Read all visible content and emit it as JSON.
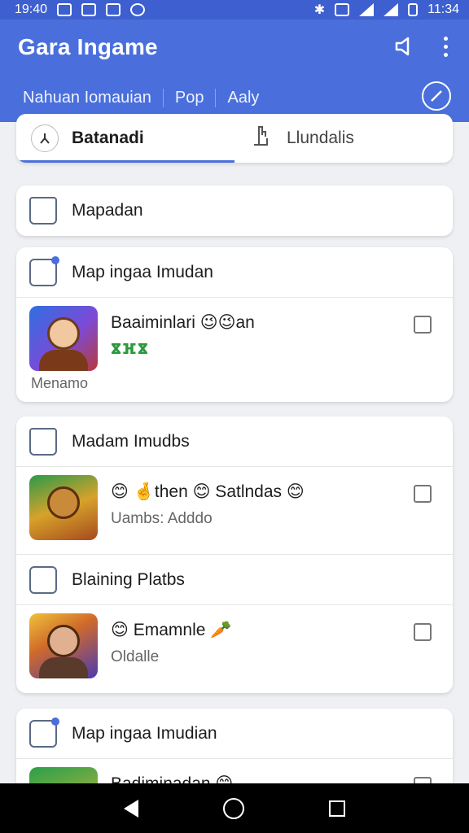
{
  "status_bar": {
    "time_left": "19:40",
    "time_right": "11:34"
  },
  "app": {
    "title": "Gara Ingame"
  },
  "subtabs": [
    "Nahuan Iomauian",
    "Pop",
    "Aaly"
  ],
  "segment_tabs": [
    {
      "label": "Batanadi",
      "icon": "person-icon",
      "active": true
    },
    {
      "label": "Llundalis",
      "icon": "hand-pointer-icon",
      "active": false
    }
  ],
  "cards": {
    "c1": {
      "section": "Mapadan"
    },
    "c2": {
      "section": "Map ingaa Imudan",
      "item": {
        "title": "Baaiminlari 😉😉an",
        "green": "ⴵⴼⴵ",
        "foot": "Menamo"
      }
    },
    "c3": {
      "section1": "Madam Imudbs",
      "item1": {
        "title": "😊 🤞then 😊 Satlndas 😊",
        "sub": "Uambs: Adddo"
      },
      "section2": "Blaining Platbs",
      "item2": {
        "title": "😊 Emamnle 🥕",
        "sub": "Oldalle"
      }
    },
    "c4": {
      "section": "Map ingaa Imudian",
      "item": {
        "title": "Badiminadan 😊"
      }
    }
  },
  "colors": {
    "accent": "#4a6fdc",
    "status_bar": "#3d5fd0"
  }
}
